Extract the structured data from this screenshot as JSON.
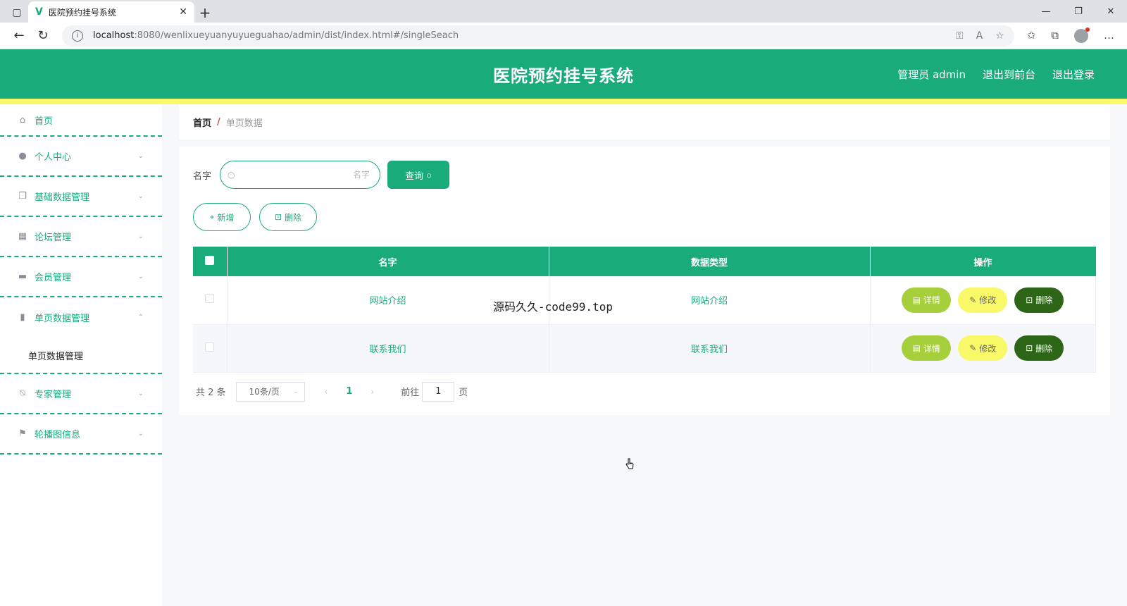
{
  "browser": {
    "tab_title": "医院预约挂号系统",
    "url_host": "localhost",
    "url_path": ":8080/wenlixueyuanyuyueguahao/admin/dist/index.html#/singleSeach",
    "window_controls": [
      "—",
      "❐",
      "✕"
    ]
  },
  "header": {
    "title": "医院预约挂号系统",
    "user": "管理员 admin",
    "to_front": "退出到前台",
    "logout": "退出登录"
  },
  "sidebar": {
    "items": [
      {
        "label": "首页",
        "icon": "home-icon"
      },
      {
        "label": "个人中心",
        "icon": "user-icon"
      },
      {
        "label": "基础数据管理",
        "icon": "copy-icon"
      },
      {
        "label": "论坛管理",
        "icon": "grid-icon"
      },
      {
        "label": "会员管理",
        "icon": "briefcase-icon"
      },
      {
        "label": "单页数据管理",
        "icon": "bar-chart-icon"
      },
      {
        "label": "专家管理",
        "icon": "bell-off-icon"
      },
      {
        "label": "轮播图信息",
        "icon": "flag-icon"
      }
    ],
    "submenu_label": "单页数据管理"
  },
  "breadcrumb": {
    "home": "首页",
    "separator": "/",
    "current": "单页数据"
  },
  "search": {
    "label": "名字",
    "placeholder": "名字",
    "button": "查询"
  },
  "actions": {
    "add": "新增",
    "delete": "删除"
  },
  "table": {
    "headers": [
      "名字",
      "数据类型",
      "操作"
    ],
    "rows": [
      {
        "name": "网站介绍",
        "type": "网站介绍"
      },
      {
        "name": "联系我们",
        "type": "联系我们"
      }
    ],
    "ops": {
      "detail": "详情",
      "edit": "修改",
      "delete": "删除"
    }
  },
  "pager": {
    "total": "共 2 条",
    "page_size": "10条/页",
    "current_page": "1",
    "goto_label": "前往",
    "goto_value": "1",
    "page_unit": "页"
  },
  "notice": "源码久久-code99.top",
  "colors": {
    "primary": "#1aab7a",
    "accent_yellow": "#f8f868",
    "detail_green": "#a6cf3b",
    "delete_dark": "#2d6616"
  }
}
